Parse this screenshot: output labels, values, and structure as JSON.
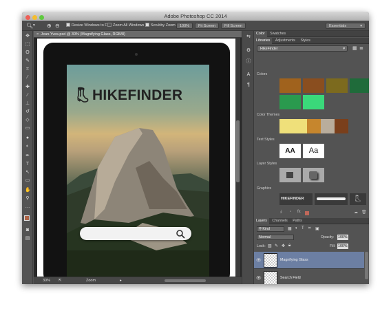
{
  "window": {
    "title": "Adobe Photoshop CC 2014"
  },
  "options_bar": {
    "resize_windows": "Resize Windows to Fit",
    "zoom_all": "Zoom All Windows",
    "scrubby": "Scrubby Zoom",
    "zoom_percent": "100%",
    "fit_screen": "Fit Screen",
    "fill_screen": "Fill Screen",
    "workspace": "Essentials"
  },
  "document": {
    "tab_title": "Jean-Yves.psd @ 30% (Magnifying Glass, RGB/8)",
    "brand": "HIKEFINDER"
  },
  "status_bar": {
    "zoom": "30%",
    "tool": "Zoom"
  },
  "panels": {
    "top_tabs": [
      "Color",
      "Swatches"
    ],
    "lib_tabs": [
      "Libraries",
      "Adjustments",
      "Styles"
    ],
    "library_name": "HikeFinder",
    "colors_label": "Colors",
    "colors": [
      "#a0621d",
      "#8a4e1f",
      "#7c6a1e",
      "#1f6b3a",
      "#2a9a4e",
      "#3ad87a"
    ],
    "themes_label": "Color Themes",
    "theme_colors": [
      "#efe07a",
      "#c6862d",
      "#b9ad9c",
      "#7a3f1b"
    ],
    "text_styles_label": "Text Styles",
    "text_style_1": "AA",
    "text_style_2": "Aa",
    "layer_styles_label": "Layer Styles",
    "graphics_label": "Graphics",
    "graphic_brand": "HIKEFINDER"
  },
  "layers_panel": {
    "tabs": [
      "Layers",
      "Channels",
      "Paths"
    ],
    "kind_filter": "Kind",
    "blend_mode": "Normal",
    "opacity_label": "Opacity:",
    "opacity": "100%",
    "lock_label": "Lock:",
    "fill_label": "Fill:",
    "fill": "100%",
    "layers": [
      {
        "name": "Magnifying Glass",
        "selected": true
      },
      {
        "name": "Search Field",
        "selected": false
      }
    ]
  }
}
